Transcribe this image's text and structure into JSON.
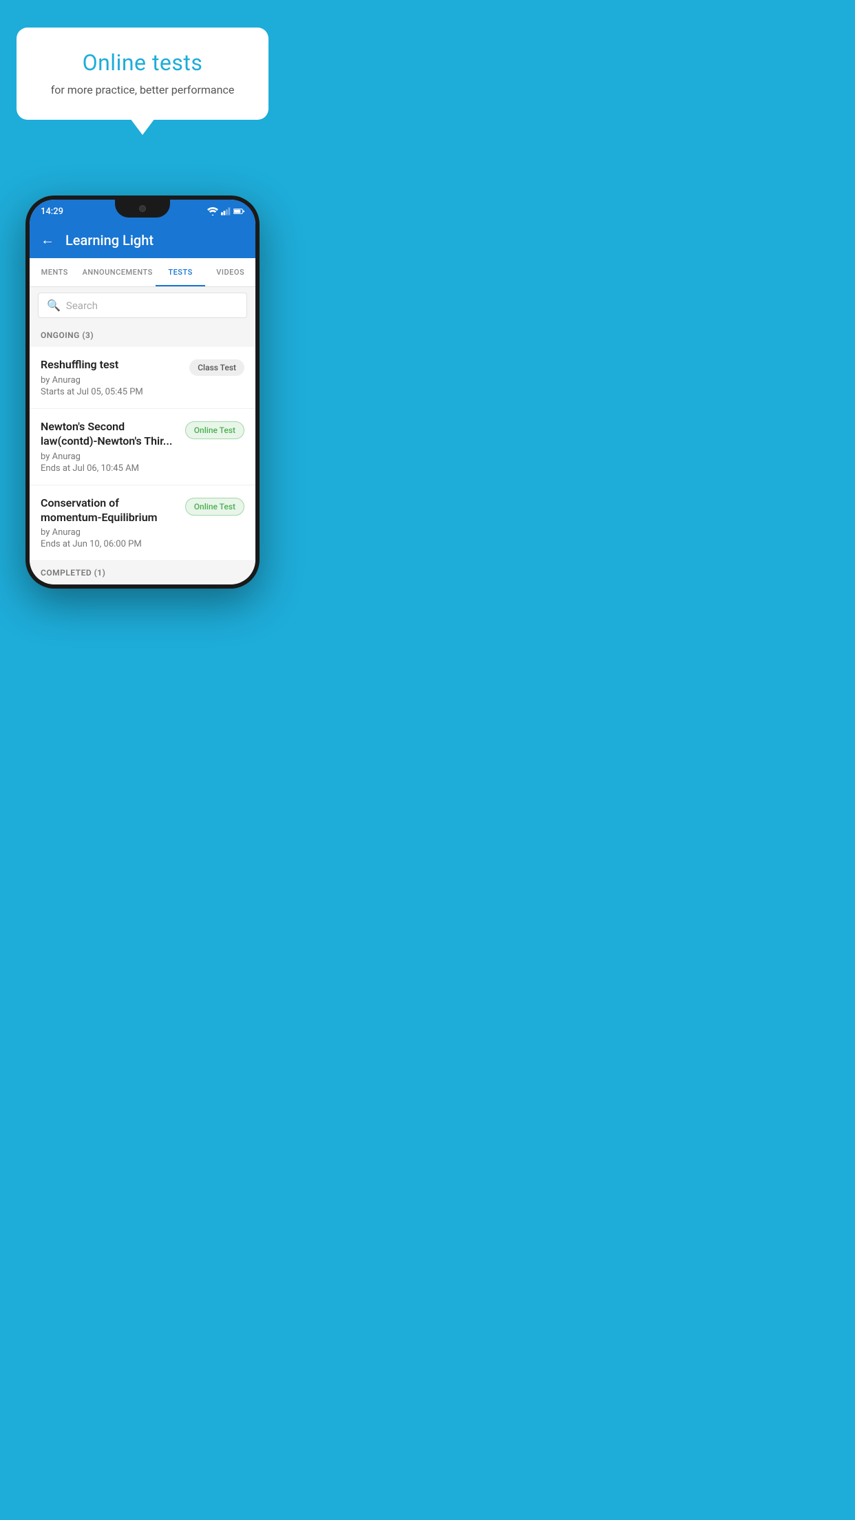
{
  "hero": {
    "title": "Online tests",
    "subtitle": "for more practice, better performance"
  },
  "status_bar": {
    "time": "14:29"
  },
  "app_bar": {
    "title": "Learning Light",
    "back_label": "←"
  },
  "tabs": [
    {
      "label": "MENTS",
      "active": false
    },
    {
      "label": "ANNOUNCEMENTS",
      "active": false
    },
    {
      "label": "TESTS",
      "active": true
    },
    {
      "label": "VIDEOS",
      "active": false
    }
  ],
  "search": {
    "placeholder": "Search"
  },
  "section": {
    "ongoing_label": "ONGOING (3)"
  },
  "tests": [
    {
      "title": "Reshuffling test",
      "author": "by Anurag",
      "date": "Starts at  Jul 05, 05:45 PM",
      "badge": "Class Test",
      "badge_type": "class"
    },
    {
      "title": "Newton's Second law(contd)-Newton's Thir...",
      "author": "by Anurag",
      "date": "Ends at  Jul 06, 10:45 AM",
      "badge": "Online Test",
      "badge_type": "online"
    },
    {
      "title": "Conservation of momentum-Equilibrium",
      "author": "by Anurag",
      "date": "Ends at  Jun 10, 06:00 PM",
      "badge": "Online Test",
      "badge_type": "online"
    }
  ],
  "completed_label": "COMPLETED (1)",
  "colors": {
    "background": "#1EACD8",
    "app_bar": "#1976D2",
    "active_tab": "#1976D2"
  }
}
